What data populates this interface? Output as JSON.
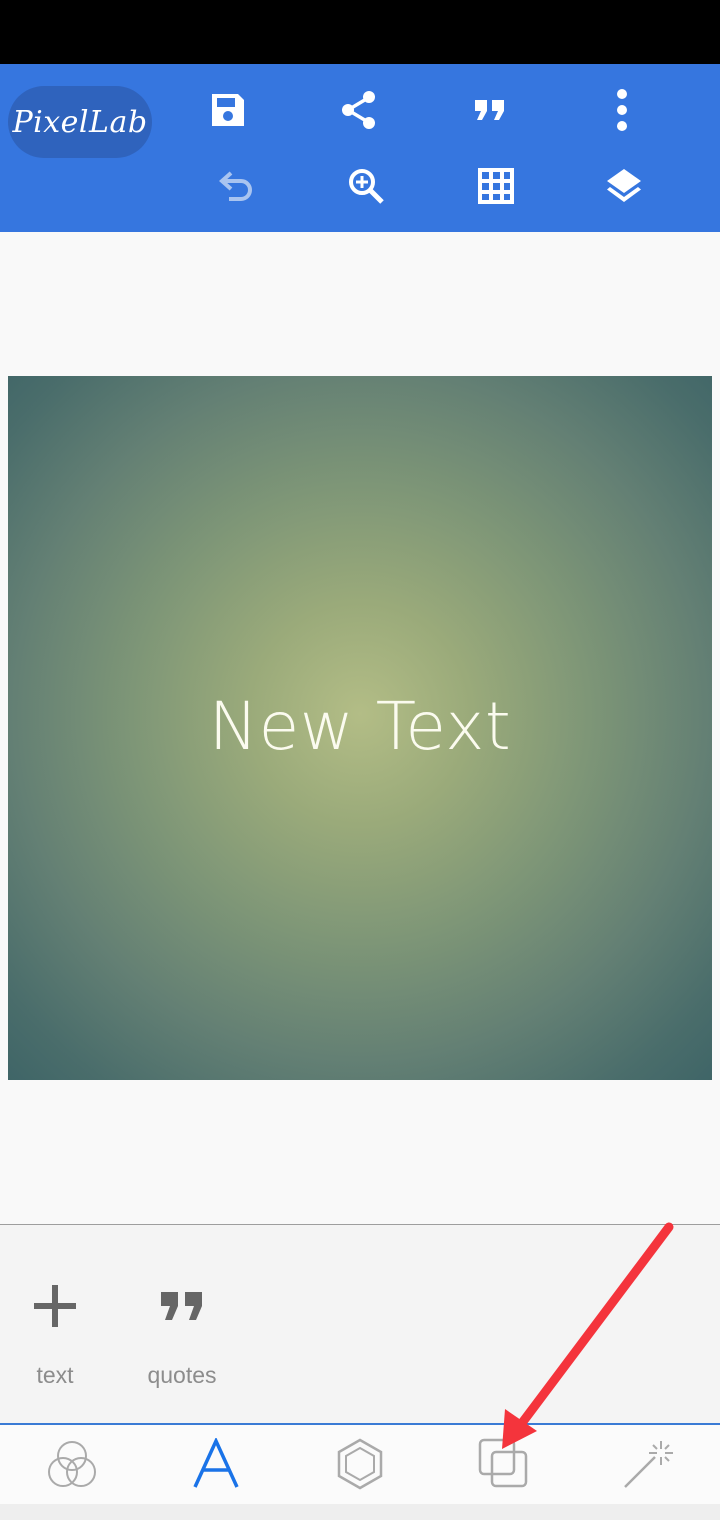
{
  "app": {
    "logo_text": "PixelLab"
  },
  "toolbar": {
    "row1": [
      {
        "name": "add-icon"
      },
      {
        "name": "save-icon"
      },
      {
        "name": "share-icon"
      },
      {
        "name": "quote-icon"
      },
      {
        "name": "more-vert-icon"
      }
    ],
    "row2": [
      {
        "name": "undo-icon"
      },
      {
        "name": "zoom-in-icon"
      },
      {
        "name": "grid-icon"
      },
      {
        "name": "layers-icon"
      }
    ]
  },
  "canvas": {
    "text": "New Text",
    "gradient_center_color": "#b3bd86",
    "gradient_edge_color": "#3f6567"
  },
  "sub_panel": {
    "items": [
      {
        "label": "text",
        "icon": "plus-icon"
      },
      {
        "label": "quotes",
        "icon": "quote-icon"
      }
    ]
  },
  "bottom_nav": {
    "items": [
      {
        "icon": "color-circles-icon",
        "active": false
      },
      {
        "icon": "text-a-icon",
        "active": true
      },
      {
        "icon": "hexagon-icon",
        "active": false
      },
      {
        "icon": "layers-squares-icon",
        "active": false
      },
      {
        "icon": "magic-wand-icon",
        "active": false
      }
    ]
  },
  "colors": {
    "toolbar_blue": "#3676df",
    "accent_blue": "#1a73e8",
    "annotation_red": "#f4343c"
  }
}
